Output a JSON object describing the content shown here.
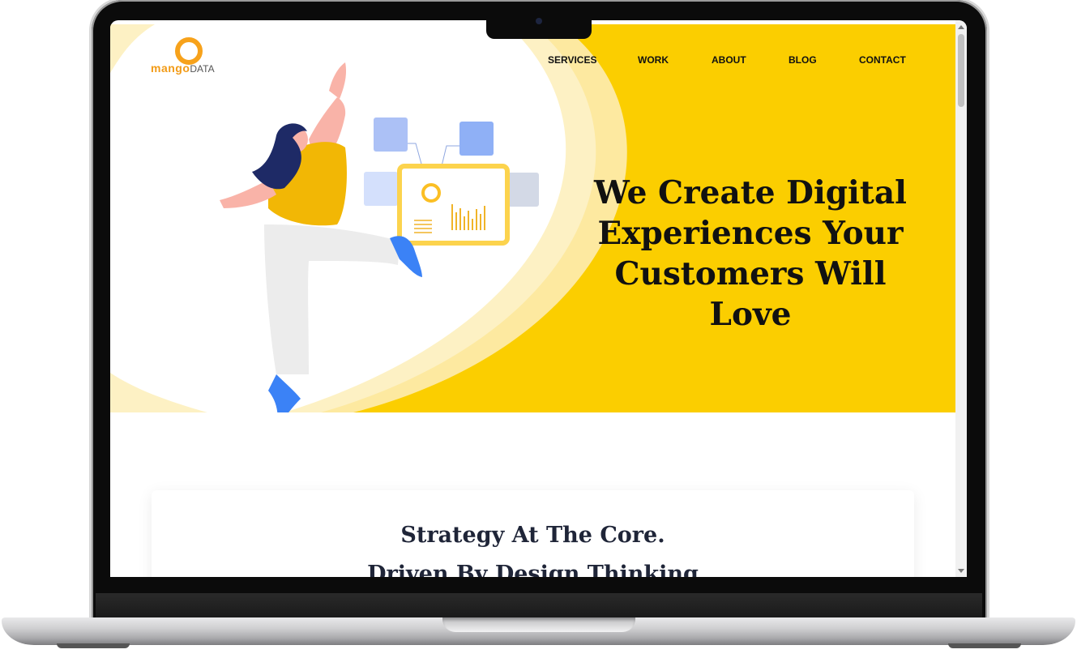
{
  "brand": {
    "logo_primary": "mango",
    "logo_secondary": "DATA",
    "color": "#f29b17"
  },
  "nav": {
    "items": [
      {
        "label": "SERVICES",
        "key": "services"
      },
      {
        "label": "WORK",
        "key": "work"
      },
      {
        "label": "ABOUT",
        "key": "about"
      },
      {
        "label": "BLOG",
        "key": "blog"
      },
      {
        "label": "CONTACT",
        "key": "contact"
      }
    ]
  },
  "hero": {
    "headline_lines": [
      "We Create Digital",
      "Experiences Your",
      "Customers Will Love"
    ],
    "accent_color": "#fbce00"
  },
  "card": {
    "line1": "Strategy At The Core.",
    "line2": "Driven By Design Thinking"
  }
}
